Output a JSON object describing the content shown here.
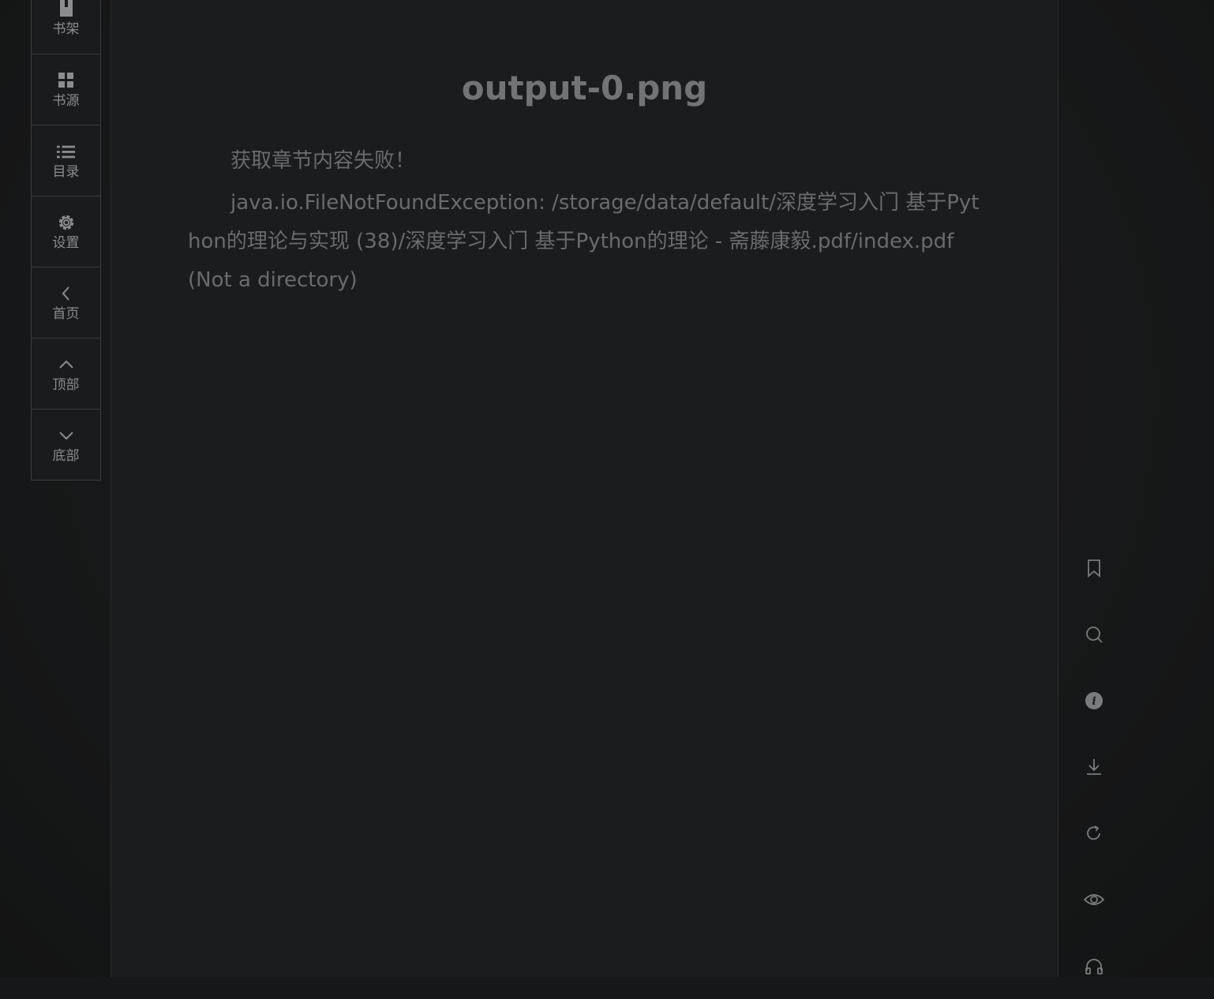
{
  "left_toolbar": {
    "items": [
      {
        "label": "书架",
        "icon": "bookshelf-icon"
      },
      {
        "label": "书源",
        "icon": "grid-icon"
      },
      {
        "label": "目录",
        "icon": "list-icon"
      },
      {
        "label": "设置",
        "icon": "gear-icon"
      },
      {
        "label": "首页",
        "icon": "chevron-left-icon"
      },
      {
        "label": "顶部",
        "icon": "chevron-up-icon"
      },
      {
        "label": "底部",
        "icon": "chevron-down-icon"
      }
    ]
  },
  "chapter": {
    "title": "output-0.png",
    "paragraphs": [
      "获取章节内容失败！",
      "java.io.FileNotFoundException: /storage/data/default/深度学习入门 基于Python的理论与实现 (38)/深度学习入门 基于Python的理论 - 斋藤康毅.pdf/index.pdf (Not a directory)"
    ]
  },
  "right_toolbar": {
    "icons": [
      "bookmark-icon",
      "search-icon",
      "info-icon",
      "download-icon",
      "refresh-icon",
      "eye-icon",
      "headphones-icon"
    ]
  },
  "colors": {
    "background": "#161718",
    "panel": "#1b1c1d",
    "text": "#6a6b6c",
    "title": "#727374",
    "toolbar_text": "#8c8d8e"
  }
}
